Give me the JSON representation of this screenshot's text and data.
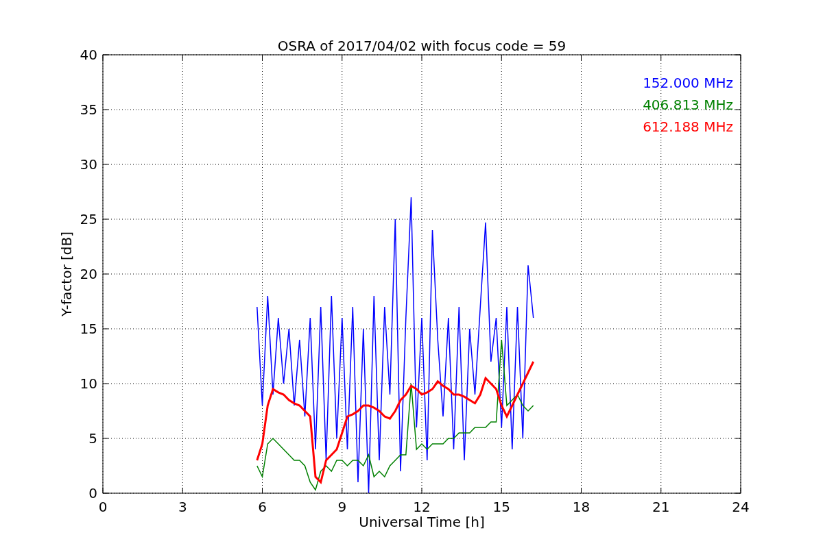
{
  "chart_data": {
    "type": "line",
    "title": "OSRA of 2017/04/02 with focus code = 59",
    "xlabel": "Universal Time [h]",
    "ylabel": "Y-factor [dB]",
    "x": [
      5.8,
      6,
      6.2,
      6.4,
      6.6,
      6.8,
      7,
      7.2,
      7.4,
      7.6,
      7.8,
      8,
      8.2,
      8.4,
      8.6,
      8.8,
      9,
      9.2,
      9.4,
      9.6,
      9.8,
      10,
      10.2,
      10.4,
      10.6,
      10.8,
      11,
      11.2,
      11.4,
      11.6,
      11.8,
      12,
      12.2,
      12.4,
      12.6,
      12.8,
      13,
      13.2,
      13.4,
      13.6,
      13.8,
      14,
      14.2,
      14.4,
      14.6,
      14.8,
      15,
      15.2,
      15.4,
      15.6,
      15.8,
      16,
      16.2
    ],
    "series": [
      {
        "name": "152.000 MHz",
        "color": "#0000ff",
        "values": [
          17,
          8,
          18,
          9,
          16,
          10,
          15,
          8,
          14,
          7,
          16,
          4,
          17,
          3,
          18,
          5,
          16,
          4,
          17,
          1,
          15,
          0,
          18,
          3,
          17,
          9,
          25,
          2,
          16,
          27,
          6,
          16,
          3,
          24,
          14,
          7,
          16,
          4,
          17,
          3,
          15,
          9,
          17,
          24.7,
          12,
          16,
          6,
          17,
          4,
          17,
          5,
          20.8,
          16
        ]
      },
      {
        "name": "406.813 MHz",
        "color": "#008000",
        "values": [
          2.5,
          1.5,
          4.5,
          5,
          4.5,
          4,
          3.5,
          3,
          3,
          2.5,
          1,
          0.3,
          2,
          2.5,
          2,
          3,
          3,
          2.5,
          3,
          3,
          2.5,
          3.5,
          1.5,
          2,
          1.5,
          2.5,
          3,
          3.5,
          3.5,
          10,
          4,
          4.5,
          4,
          4.5,
          4.5,
          4.5,
          5,
          5,
          5.5,
          5.5,
          5.5,
          6,
          6,
          6,
          6.5,
          6.5,
          14,
          8,
          8.5,
          9,
          8,
          7.5,
          8
        ]
      },
      {
        "name": "612.188 MHz",
        "color": "#ff0000",
        "values": [
          3,
          4.5,
          8,
          9.5,
          9.2,
          9,
          8.5,
          8.2,
          8,
          7.5,
          7,
          1.5,
          1,
          3,
          3.5,
          4,
          5.5,
          7,
          7.2,
          7.5,
          8,
          8,
          7.8,
          7.5,
          7,
          6.8,
          7.5,
          8.5,
          9,
          9.8,
          9.5,
          9,
          9.2,
          9.5,
          10.2,
          9.8,
          9.5,
          9,
          9,
          8.8,
          8.5,
          8.2,
          9,
          10.5,
          10,
          9.5,
          8,
          7,
          8,
          9,
          10,
          11,
          12
        ]
      }
    ],
    "grid": true,
    "xlim": [
      0,
      24
    ],
    "ylim": [
      0,
      40
    ],
    "xticks": [
      0,
      3,
      6,
      9,
      12,
      15,
      18,
      21,
      24
    ],
    "yticks": [
      0,
      5,
      10,
      15,
      20,
      25,
      30,
      35,
      40
    ]
  }
}
